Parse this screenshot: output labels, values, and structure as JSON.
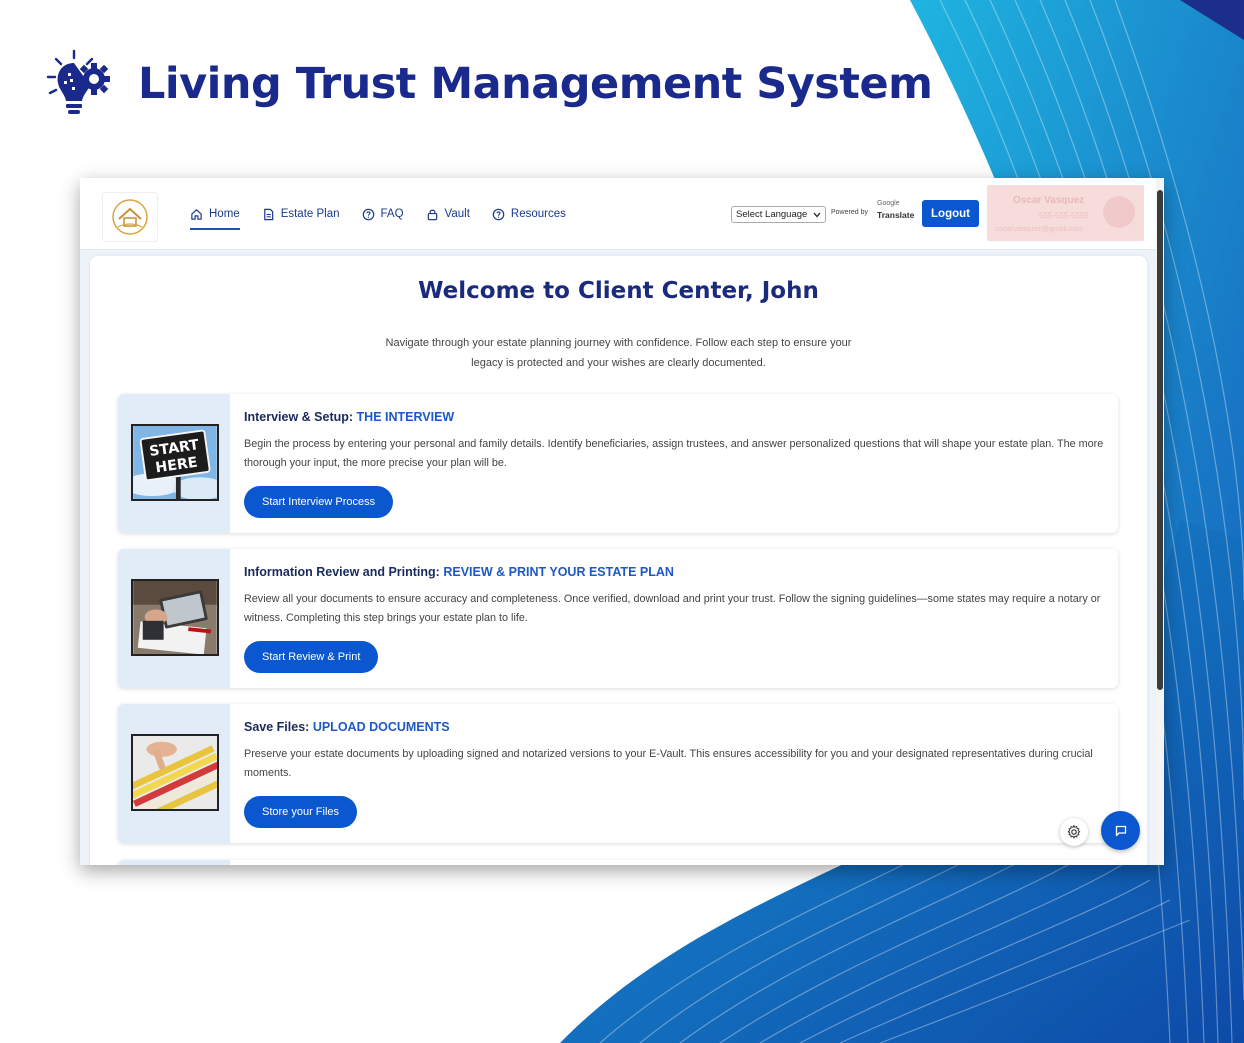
{
  "banner": {
    "title": "Living Trust Management System"
  },
  "navbar": {
    "items": [
      {
        "label": "Home",
        "icon": "home-icon",
        "active": true
      },
      {
        "label": "Estate Plan",
        "icon": "document-icon",
        "active": false
      },
      {
        "label": "FAQ",
        "icon": "help-circle-icon",
        "active": false
      },
      {
        "label": "Vault",
        "icon": "lock-icon",
        "active": false
      },
      {
        "label": "Resources",
        "icon": "help-circle-icon",
        "active": false
      }
    ],
    "language_select": "Select Language",
    "powered_by": "Powered by",
    "google": "Google",
    "translate": "Translate",
    "logout": "Logout"
  },
  "profile": {
    "name": "Oscar Vasquez",
    "phone": "555-555-5555",
    "email": "oscarvasquez@gmail.com"
  },
  "main": {
    "welcome": "Welcome to Client Center, John",
    "intro": "Navigate through your estate planning journey with confidence. Follow each step to ensure your legacy is protected and your wishes are clearly documented.",
    "cards": [
      {
        "title": "Interview & Setup:",
        "highlight": "THE INTERVIEW",
        "description": "Begin the process by entering your personal and family details. Identify beneficiaries, assign trustees, and answer personalized questions that will shape your estate plan. The more thorough your input, the more precise your plan will be.",
        "button": "Start Interview Process",
        "image_text_1": "START",
        "image_text_2": "HERE"
      },
      {
        "title": "Information Review and Printing:",
        "highlight": "REVIEW & PRINT YOUR ESTATE PLAN",
        "description": "Review all your documents to ensure accuracy and completeness. Once verified, download and print your trust. Follow the signing guidelines—some states may require a notary or witness. Completing this step brings your estate plan to life.",
        "button": "Start Review & Print"
      },
      {
        "title": "Save Files:",
        "highlight": "UPLOAD DOCUMENTS",
        "description": "Preserve your estate documents by uploading signed and notarized versions to your E-Vault. This ensures accessibility for you and your designated representatives during crucial moments.",
        "button": "Store your Files"
      }
    ]
  },
  "colors": {
    "brand_navy": "#1a2a8c",
    "primary_blue": "#0b57d0",
    "highlight_blue": "#1e57c7",
    "card_side": "#e2ecf8"
  }
}
